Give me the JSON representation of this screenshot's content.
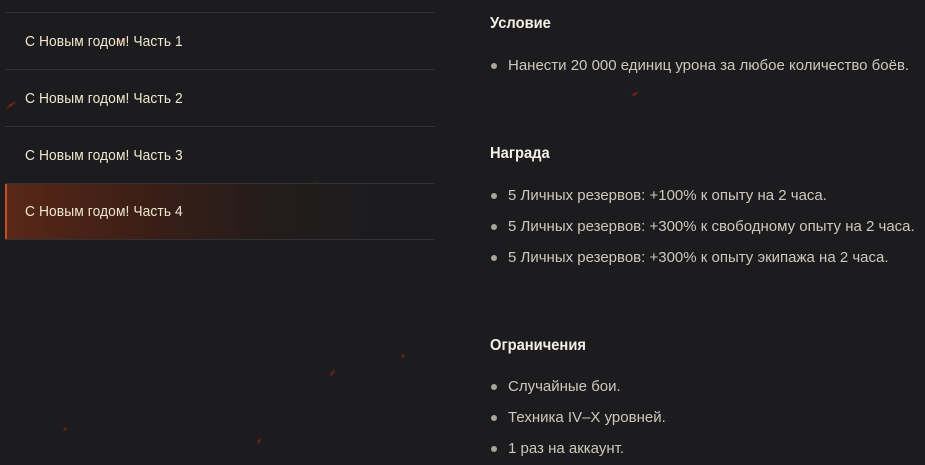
{
  "menu": {
    "items": [
      {
        "label": "С Новым годом! Часть 1",
        "active": false
      },
      {
        "label": "С Новым годом! Часть 2",
        "active": false
      },
      {
        "label": "С Новым годом! Часть 3",
        "active": false
      },
      {
        "label": "С Новым годом! Часть 4",
        "active": true
      }
    ]
  },
  "sections": {
    "condition": {
      "title": "Условие",
      "items": [
        "Нанести 20 000 единиц урона за любое количество боёв."
      ]
    },
    "reward": {
      "title": "Награда",
      "items": [
        "5 Личных резервов: +100% к опыту на 2 часа.",
        "5 Личных резервов: +300% к свободному опыту на 2 часа.",
        "5 Личных резервов: +300% к опыту экипажа на 2 часа."
      ]
    },
    "restrictions": {
      "title": "Ограничения",
      "items": [
        "Случайные бои.",
        "Техника IV–X уровней.",
        "1 раз на аккаунт."
      ]
    }
  },
  "colors": {
    "background": "#1c1c1e",
    "accent": "#c44a28",
    "title_text": "#f3efe4",
    "body_text": "#cdc8bc"
  }
}
